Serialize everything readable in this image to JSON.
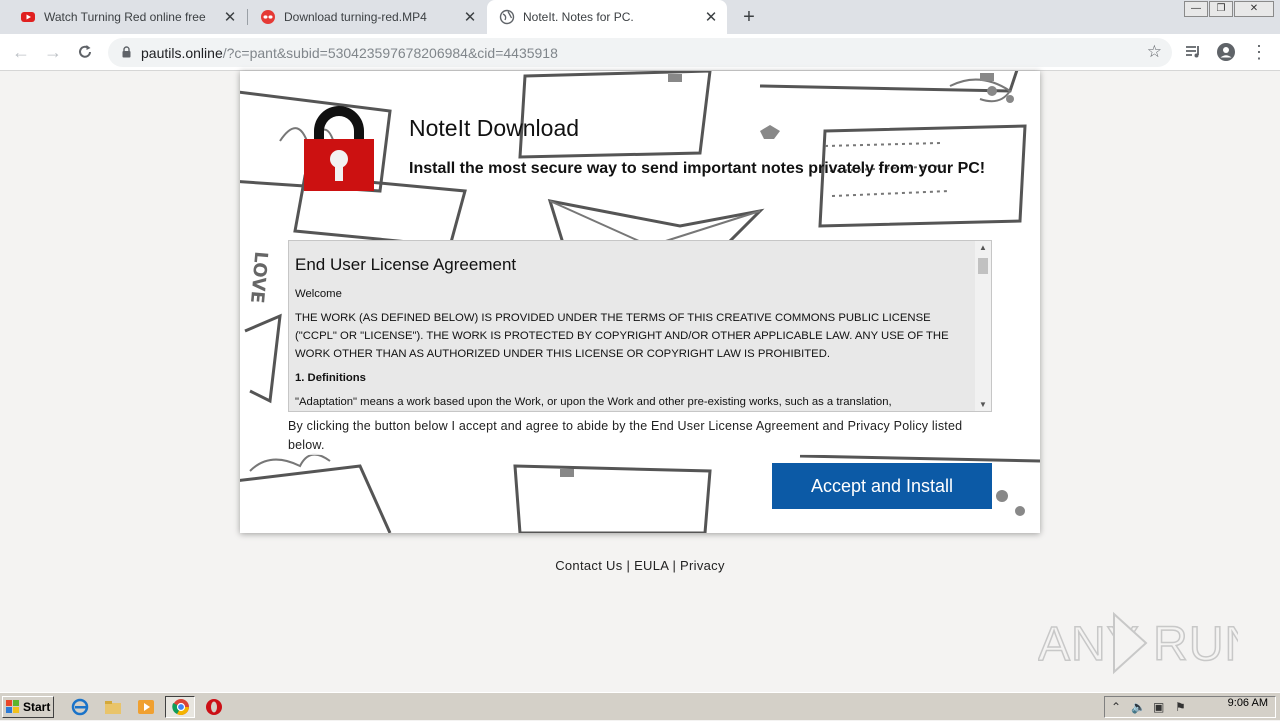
{
  "browser": {
    "tabs": [
      {
        "title": "Watch Turning Red online free",
        "icon": "youtube-icon"
      },
      {
        "title": "Download turning-red.MP4",
        "icon": "red-mask-icon"
      },
      {
        "title": "NoteIt. Notes for PC.",
        "icon": "globe-icon",
        "active": true
      }
    ],
    "new_tab_label": "+",
    "close_label": "✕",
    "url_host": "pautils.online",
    "url_path": "/?c=pant&subid=530423597678206984&cid=4435918"
  },
  "page": {
    "app_title": "NoteIt Download",
    "app_subtitle": "Install the most secure way to send important notes privately from your PC!",
    "eula": {
      "heading": "End User License Agreement",
      "welcome": "Welcome",
      "body": "THE WORK (AS DEFINED BELOW) IS PROVIDED UNDER THE TERMS OF THIS CREATIVE COMMONS PUBLIC LICENSE (\"CCPL\" OR \"LICENSE\"). THE WORK IS PROTECTED BY COPYRIGHT AND/OR OTHER APPLICABLE LAW. ANY USE OF THE WORK OTHER THAN AS AUTHORIZED UNDER THIS LICENSE OR COPYRIGHT LAW IS PROHIBITED.",
      "section_title": "1. Definitions",
      "section_body": "\"Adaptation\" means a work based upon the Work, or upon the Work and other pre-existing works, such as a translation,"
    },
    "consent_text": "By clicking the button below I accept and agree to abide by the End User License Agreement and Privacy Policy listed below.",
    "accept_button": "Accept and Install",
    "footer": {
      "contact": "Contact Us",
      "eula": "EULA",
      "privacy": "Privacy",
      "separator": "|"
    },
    "colors": {
      "accept_button": "#0c5aa6",
      "lock_body": "#cc1111"
    }
  },
  "watermark": "ANY RUN",
  "taskbar": {
    "start_label": "Start",
    "clock": "9:06 AM"
  }
}
